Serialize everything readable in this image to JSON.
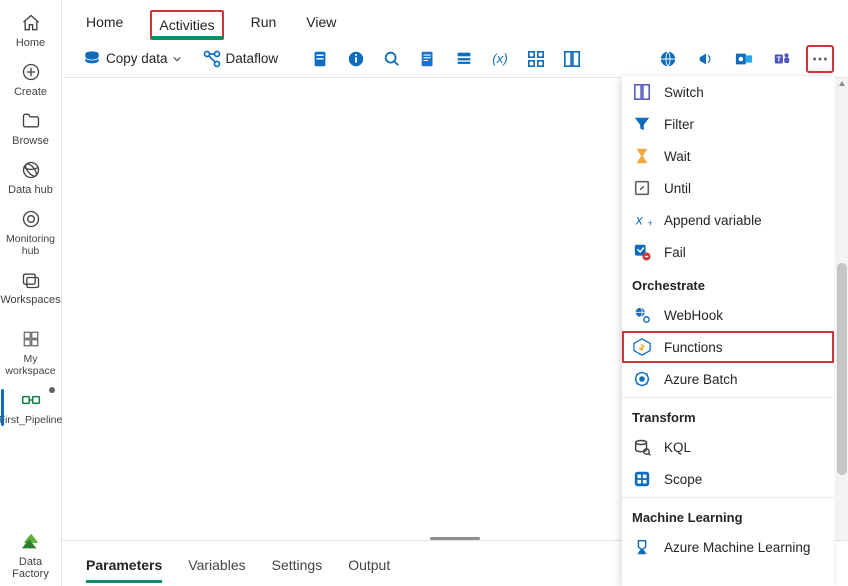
{
  "leftnav": {
    "items": [
      {
        "id": "home",
        "label": "Home"
      },
      {
        "id": "create",
        "label": "Create"
      },
      {
        "id": "browse",
        "label": "Browse"
      },
      {
        "id": "datahub",
        "label": "Data hub"
      },
      {
        "id": "monitoring",
        "label": "Monitoring hub"
      },
      {
        "id": "workspaces",
        "label": "Workspaces"
      }
    ],
    "myworkspace_label": "My workspace",
    "first_pipeline_label": "First_Pipeline",
    "datafactory_label": "Data Factory"
  },
  "topTabs": {
    "items": [
      {
        "id": "home",
        "label": "Home"
      },
      {
        "id": "activities",
        "label": "Activities"
      },
      {
        "id": "run",
        "label": "Run"
      },
      {
        "id": "view",
        "label": "View"
      }
    ],
    "active": "activities"
  },
  "toolbar": {
    "copydata_label": "Copy data",
    "dataflow_label": "Dataflow"
  },
  "panel": {
    "control": [
      {
        "id": "switch",
        "label": "Switch"
      },
      {
        "id": "filter",
        "label": "Filter"
      },
      {
        "id": "wait",
        "label": "Wait"
      },
      {
        "id": "until",
        "label": "Until"
      },
      {
        "id": "append",
        "label": "Append variable"
      },
      {
        "id": "fail",
        "label": "Fail"
      }
    ],
    "section_orchestrate": "Orchestrate",
    "orchestrate": [
      {
        "id": "webhook",
        "label": "WebHook"
      },
      {
        "id": "functions",
        "label": "Functions"
      },
      {
        "id": "azurebatch",
        "label": "Azure Batch"
      }
    ],
    "section_transform": "Transform",
    "transform": [
      {
        "id": "kql",
        "label": "KQL"
      },
      {
        "id": "scope",
        "label": "Scope"
      }
    ],
    "section_ml": "Machine Learning",
    "ml": [
      {
        "id": "aml",
        "label": "Azure Machine Learning"
      }
    ]
  },
  "bottomTabs": {
    "items": [
      {
        "id": "parameters",
        "label": "Parameters"
      },
      {
        "id": "variables",
        "label": "Variables"
      },
      {
        "id": "settings",
        "label": "Settings"
      },
      {
        "id": "output",
        "label": "Output"
      }
    ],
    "active": "parameters"
  }
}
